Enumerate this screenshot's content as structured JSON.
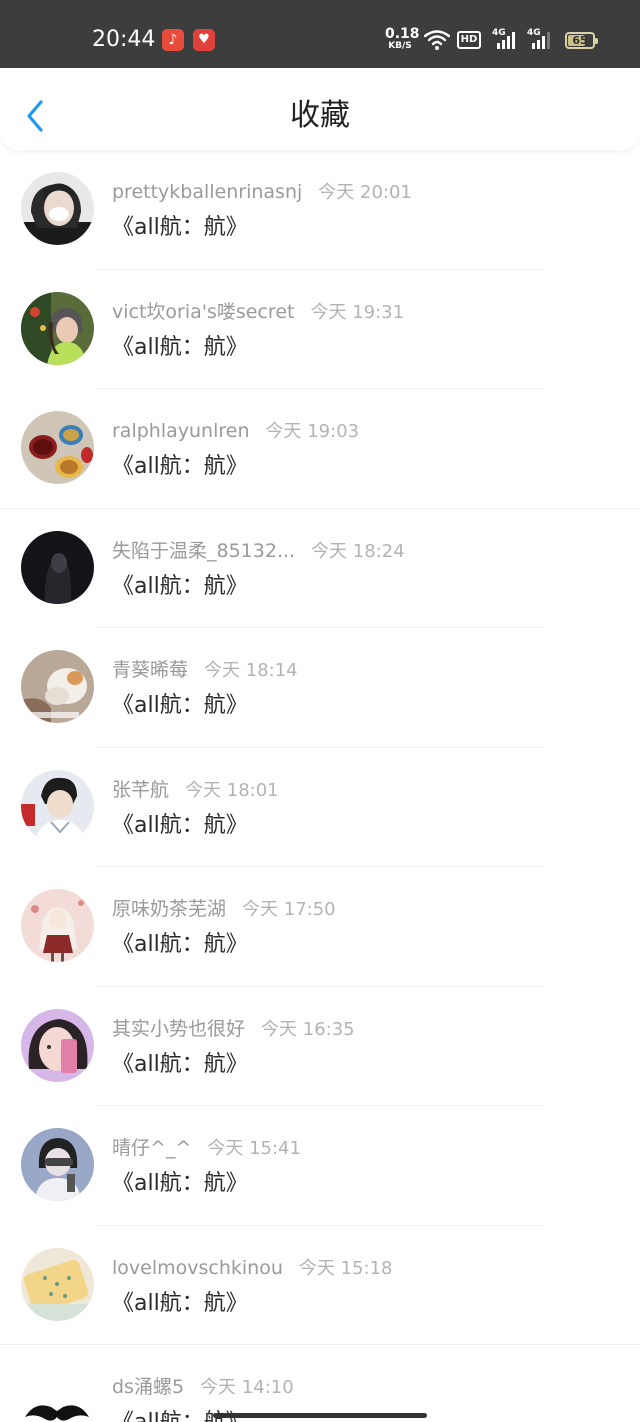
{
  "status_bar": {
    "time": "20:44",
    "net_speed_value": "0.18",
    "net_speed_unit": "KB/S",
    "hd_label": "HD",
    "signal1_label": "4G",
    "signal2_label": "4G",
    "battery": "65",
    "battery_level": 0.65,
    "app_icons": [
      "music-note-icon",
      "heart-chat-icon"
    ]
  },
  "header": {
    "back_icon": "chevron-left-icon",
    "title": "收藏",
    "accent": "#1e9bf0"
  },
  "items": [
    {
      "name": "prettykballenrinasnj",
      "time": "今天 20:01",
      "text": "《all航：航》"
    },
    {
      "name": "vict坎oria's喽secret",
      "time": "今天 19:31",
      "text": "《all航：航》"
    },
    {
      "name": "ralphlayunlren",
      "time": "今天 19:03",
      "text": "《all航：航》"
    },
    {
      "name": "失陷于温柔_85132...",
      "time": "今天 18:24",
      "text": "《all航：航》"
    },
    {
      "name": "青葵晞莓",
      "time": "今天 18:14",
      "text": "《all航：航》"
    },
    {
      "name": "张芊航",
      "time": "今天 18:01",
      "text": "《all航：航》"
    },
    {
      "name": "原味奶茶芜湖",
      "time": "今天 17:50",
      "text": "《all航：航》"
    },
    {
      "name": "其实小势也很好",
      "time": "今天 16:35",
      "text": "《all航：航》"
    },
    {
      "name": "晴仔^_^",
      "time": "今天 15:41",
      "text": "《all航：航》"
    },
    {
      "name": "lovelmovschkinou",
      "time": "今天 15:18",
      "text": "《all航：航》"
    },
    {
      "name": "ds涌螺5",
      "time": "今天 14:10",
      "text": "《all航：航》"
    }
  ]
}
